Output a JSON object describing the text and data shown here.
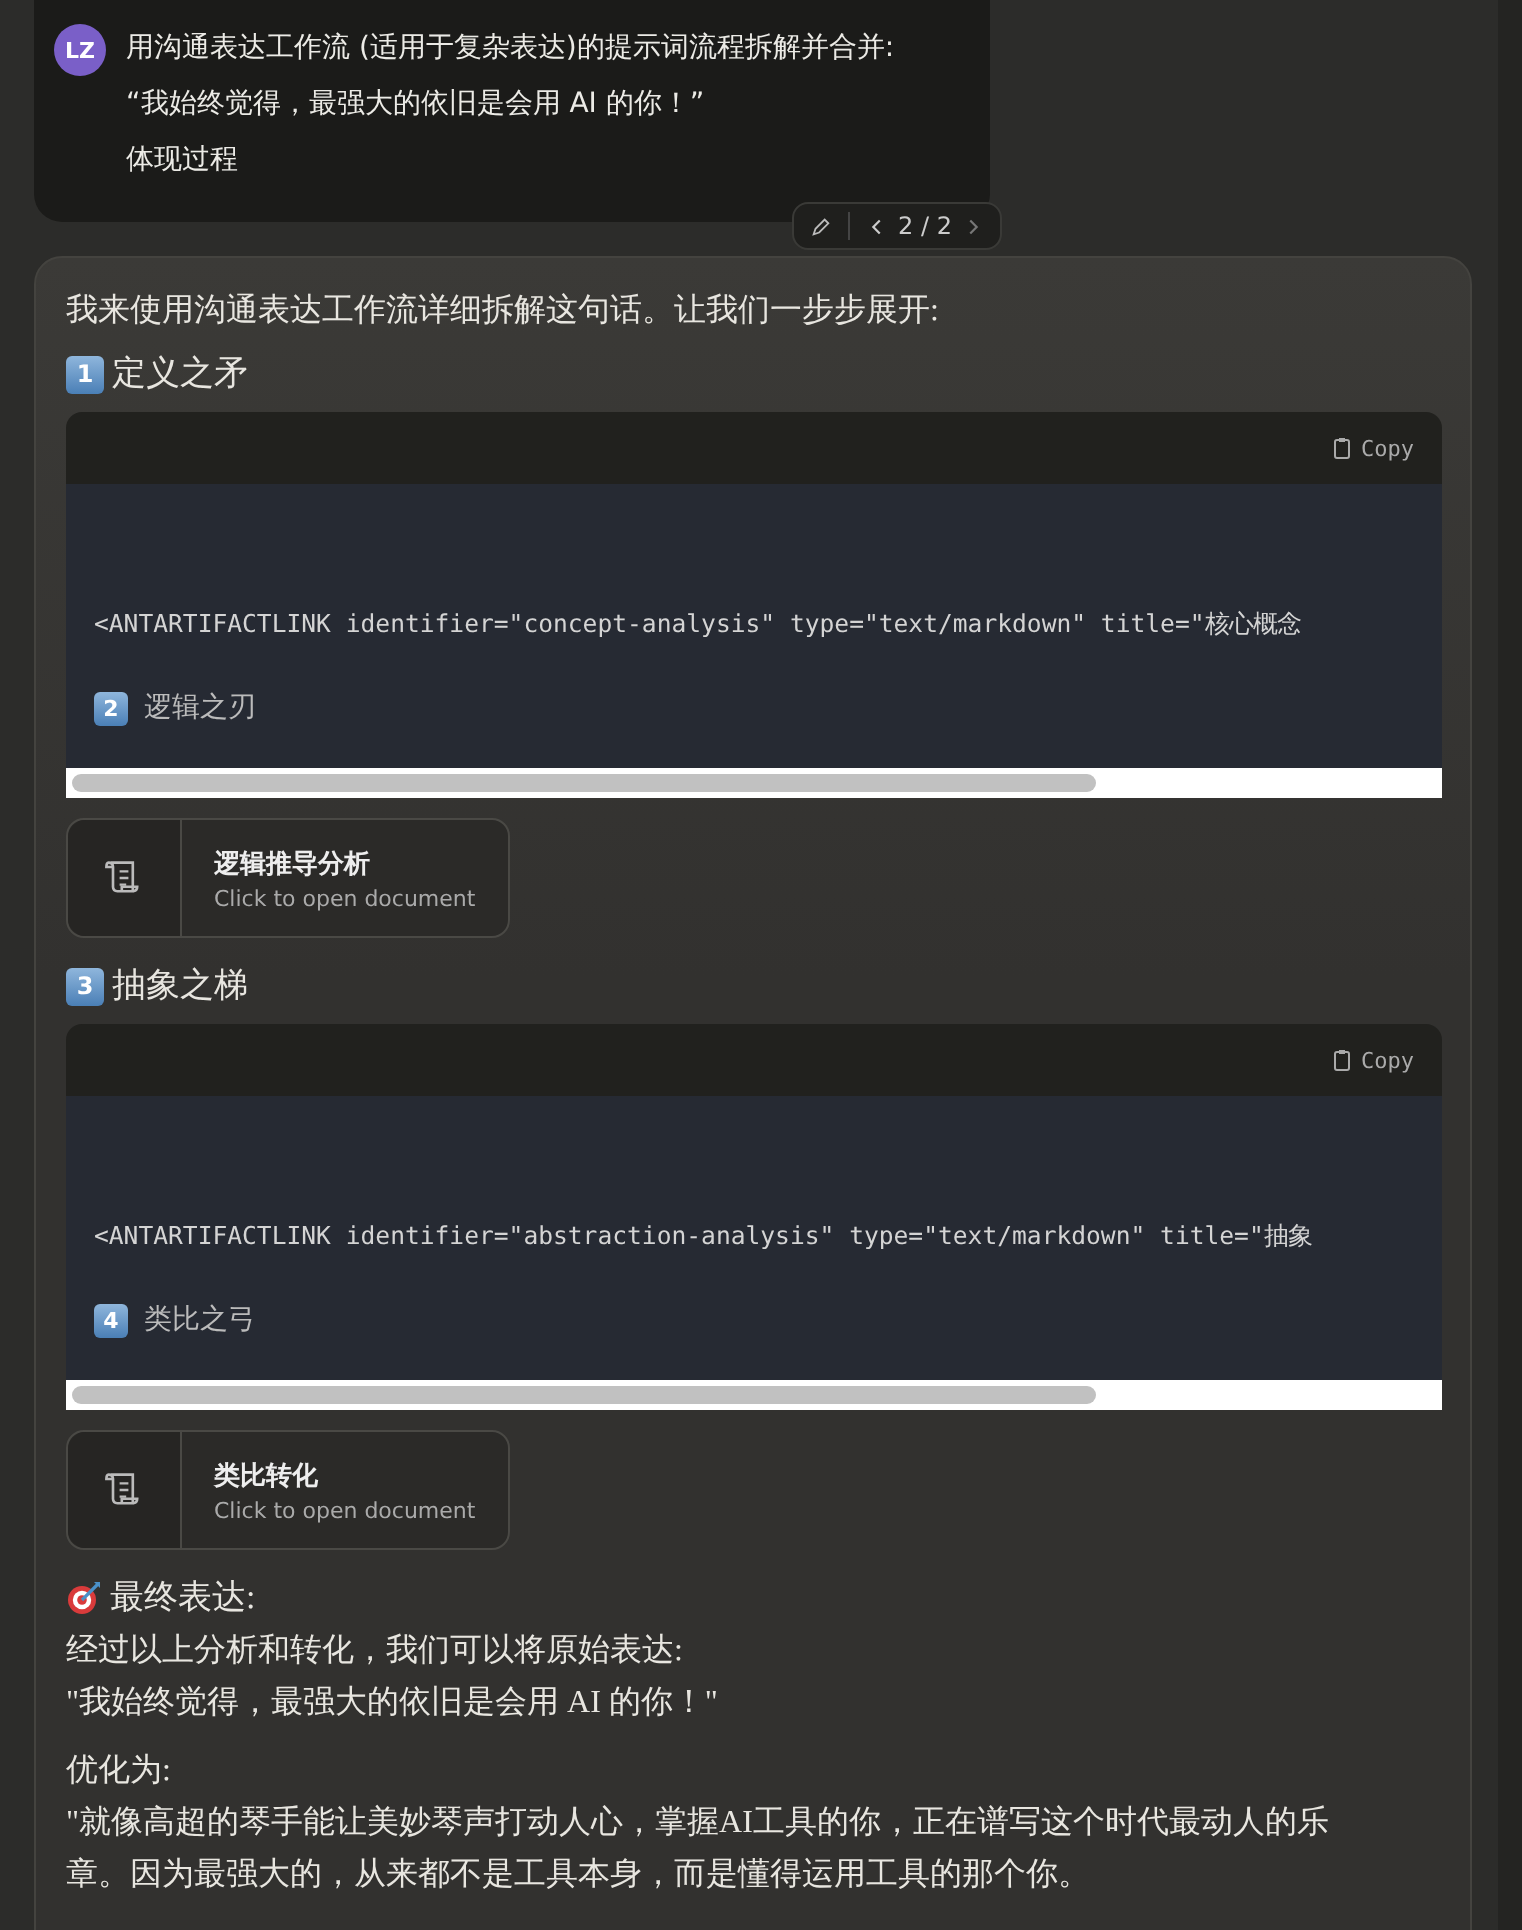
{
  "user_message": {
    "avatar": "LZ",
    "lines": [
      "用沟通表达工作流 (适用于复杂表达)的提示词流程拆解并合并:",
      "“我始终觉得，最强大的依旧是会用 AI 的你！”",
      "体现过程"
    ],
    "pager": "2 / 2"
  },
  "response": [
    {
      "kind": "paragraph",
      "text": "我来使用沟通表达工作流详细拆解这句话。让我们一步步展开:"
    },
    {
      "kind": "heading",
      "badge": "1",
      "text": "定义之矛"
    },
    {
      "kind": "code",
      "copy": "Copy",
      "code": "<ANTARTIFACTLINK identifier=\"concept-analysis\" type=\"text/markdown\" title=\"核心概念",
      "badge": "2",
      "caption": "逻辑之刃"
    },
    {
      "kind": "artifact",
      "title": "逻辑推导分析",
      "subtitle": "Click to open document"
    },
    {
      "kind": "heading",
      "badge": "3",
      "text": "抽象之梯"
    },
    {
      "kind": "code",
      "copy": "Copy",
      "code": "<ANTARTIFACTLINK identifier=\"abstraction-analysis\" type=\"text/markdown\" title=\"抽象",
      "badge": "4",
      "caption": "类比之弓"
    },
    {
      "kind": "artifact",
      "title": "类比转化",
      "subtitle": "Click to open document"
    },
    {
      "kind": "target_heading",
      "text": "最终表达:"
    },
    {
      "kind": "line",
      "text": "经过以上分析和转化，我们可以将原始表达:"
    },
    {
      "kind": "line",
      "text": "\"我始终觉得，最强大的依旧是会用 AI 的你！\""
    },
    {
      "kind": "gap_line",
      "text": "优化为:"
    },
    {
      "kind": "line",
      "text": "\"就像高超的琴手能让美妙琴声打动人心，掌握AI工具的你，正在谱写这个时代最动人的乐章。因为最强大的，从来都不是工具本身，而是懂得运用工具的那个你。"
    }
  ]
}
